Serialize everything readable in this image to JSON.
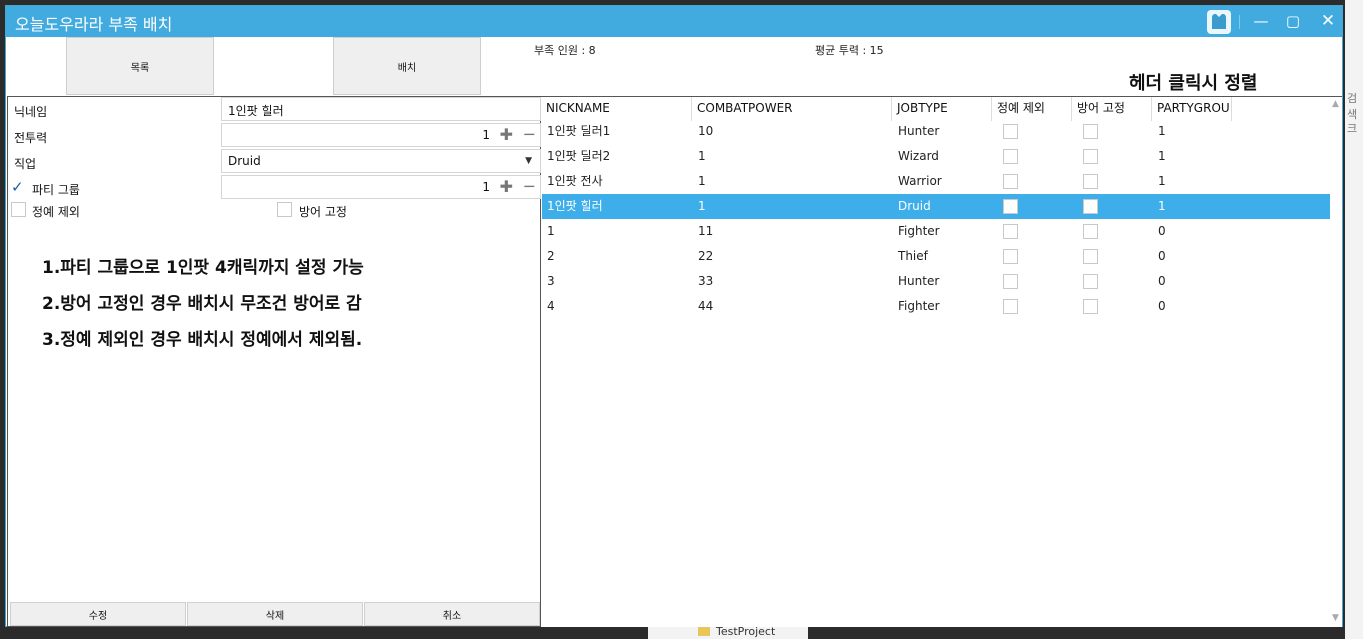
{
  "app": {
    "title": "오늘도우라라 부족 배치"
  },
  "toolbar": {
    "list_label": "목록",
    "deploy_label": "배치"
  },
  "stats": {
    "members": "부족 인원 : 8",
    "avg_power": "평균 투력 : 15"
  },
  "hint": "헤더 클릭시 정렬",
  "form": {
    "nickname_label": "닉네임",
    "nickname_value": "1인팟 힐러",
    "power_label": "전투력",
    "power_value": "1",
    "job_label": "직업",
    "job_value": "Druid",
    "party_label": "파티 그룹",
    "party_checked": true,
    "party_value": "1",
    "exclude_label": "정예 제외",
    "fixed_label": "방어 고정"
  },
  "notes": [
    "1.파티 그룹으로 1인팟 4캐릭까지 설정 가능",
    "2.방어 고정인 경우 배치시 무조건 방어로 감",
    "3.정예 제외인 경우 배치시 정예에서 제외됨."
  ],
  "actions": {
    "edit": "수정",
    "delete": "삭제",
    "cancel": "취소"
  },
  "grid": {
    "columns": [
      "NICKNAME",
      "COMBATPOWER",
      "JOBTYPE",
      "정예 제외",
      "방어 고정",
      "PARTYGROU"
    ],
    "rows": [
      {
        "nickname": "1인팟 딜러1",
        "power": "10",
        "job": "Hunter",
        "exclude": false,
        "fixed": false,
        "party": "1",
        "selected": false
      },
      {
        "nickname": "1인팟 딜러2",
        "power": "1",
        "job": "Wizard",
        "exclude": false,
        "fixed": false,
        "party": "1",
        "selected": false
      },
      {
        "nickname": "1인팟 전사",
        "power": "1",
        "job": "Warrior",
        "exclude": false,
        "fixed": false,
        "party": "1",
        "selected": false
      },
      {
        "nickname": "1인팟 힐러",
        "power": "1",
        "job": "Druid",
        "exclude": false,
        "fixed": false,
        "party": "1",
        "selected": true
      },
      {
        "nickname": "1",
        "power": "11",
        "job": "Fighter",
        "exclude": false,
        "fixed": false,
        "party": "0",
        "selected": false
      },
      {
        "nickname": "2",
        "power": "22",
        "job": "Thief",
        "exclude": false,
        "fixed": false,
        "party": "0",
        "selected": false
      },
      {
        "nickname": "3",
        "power": "33",
        "job": "Hunter",
        "exclude": false,
        "fixed": false,
        "party": "0",
        "selected": false
      },
      {
        "nickname": "4",
        "power": "44",
        "job": "Fighter",
        "exclude": false,
        "fixed": false,
        "party": "0",
        "selected": false
      }
    ]
  },
  "background": {
    "folder_label": "TestProject",
    "side_text_1": "검색",
    "side_text_2": "크"
  },
  "colors": {
    "titlebar": "#41abe0",
    "selection": "#3daee9",
    "checkmark": "#1b5fa8"
  }
}
